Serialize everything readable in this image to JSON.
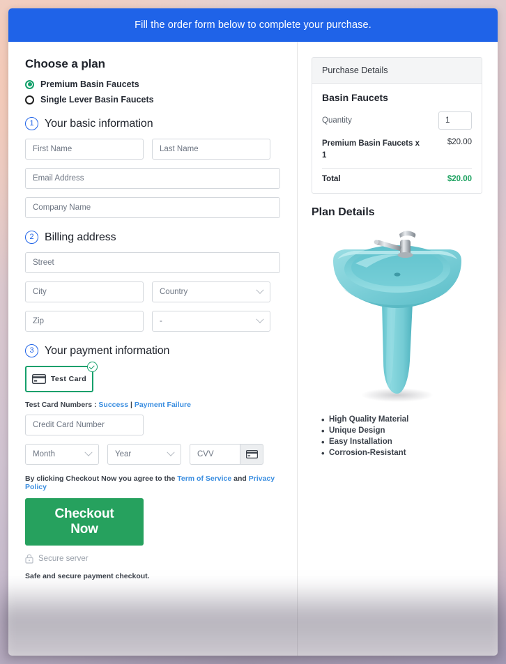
{
  "banner": {
    "text": "Fill the order form below to complete your purchase."
  },
  "plan": {
    "heading": "Choose a plan",
    "options": [
      {
        "label": "Premium Basin Faucets",
        "selected": true
      },
      {
        "label": "Single Lever Basin Faucets",
        "selected": false
      }
    ]
  },
  "steps": {
    "basic": {
      "number": "1",
      "title": "Your basic information"
    },
    "billing": {
      "number": "2",
      "title": "Billing address"
    },
    "payment": {
      "number": "3",
      "title": "Your payment information"
    }
  },
  "fields": {
    "first_name": "First Name",
    "last_name": "Last Name",
    "email": "Email Address",
    "company": "Company Name",
    "street": "Street",
    "city": "City",
    "country": "Country",
    "zip": "Zip",
    "state": "-",
    "credit_card": "Credit Card Number",
    "month": "Month",
    "year": "Year",
    "cvv": "CVV"
  },
  "payment": {
    "test_card_label": "Test Card",
    "test_numbers_prefix": "Test Card Numbers :",
    "success_link": "Success",
    "separator": "|",
    "failure_link": "Payment Failure"
  },
  "footer": {
    "terms_prefix": "By clicking Checkout Now you agree to the",
    "terms_link": "Term of Service",
    "terms_and": "and",
    "privacy_link": "Privacy Policy",
    "checkout_label": "Checkout Now",
    "secure_server": "Secure server",
    "safe_text": "Safe and secure payment checkout."
  },
  "purchase": {
    "header": "Purchase Details",
    "product_title": "Basin Faucets",
    "quantity_label": "Quantity",
    "quantity_value": "1",
    "line_item_name": "Premium Basin Faucets x 1",
    "line_item_price": "$20.00",
    "total_label": "Total",
    "total_value": "$20.00"
  },
  "plan_details": {
    "heading": "Plan Details",
    "image_alt": "basin-faucet-sink",
    "features": [
      "High Quality Material",
      "Unique Design",
      "Easy Installation",
      "Corrosion-Resistant"
    ]
  },
  "colors": {
    "banner_blue": "#1f63e8",
    "accent_green": "#26a15e",
    "total_green": "#18a05d",
    "link_blue": "#3b8ee0",
    "step_blue": "#1f63e8",
    "sink_teal": "#7ed0d8"
  }
}
